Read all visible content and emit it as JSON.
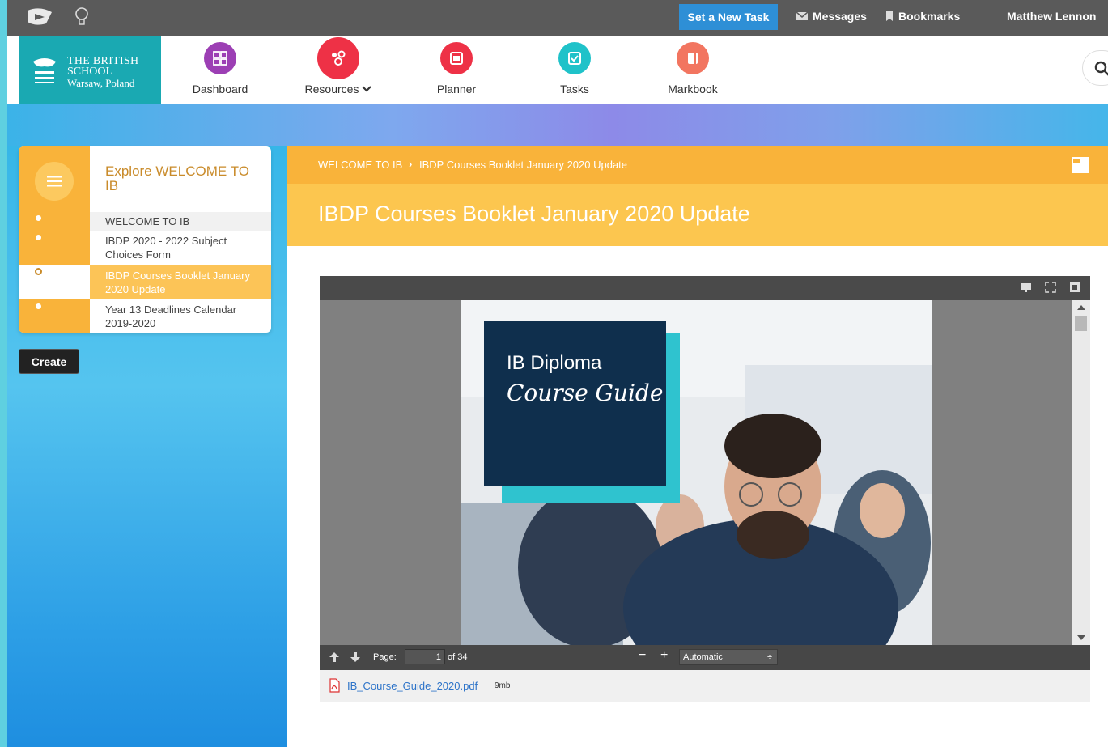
{
  "topbar": {
    "new_task_label": "Set a New Task",
    "messages_label": "Messages",
    "bookmarks_label": "Bookmarks",
    "user_name": "Matthew Lennon"
  },
  "school": {
    "line1": "THE BRITISH",
    "line2": "SCHOOL",
    "line3": "Warsaw, Poland"
  },
  "nav": {
    "items": [
      {
        "label": "Dashboard",
        "color": "#9c3fb4"
      },
      {
        "label": "Resources",
        "color": "#ee3146"
      },
      {
        "label": "Planner",
        "color": "#ee3146"
      },
      {
        "label": "Tasks",
        "color": "#1fc2c9"
      },
      {
        "label": "Markbook",
        "color": "#f27560"
      }
    ]
  },
  "sidebar": {
    "title": "Explore WELCOME TO IB",
    "items": [
      {
        "label": "WELCOME TO IB"
      },
      {
        "label": "IBDP 2020 - 2022 Subject Choices Form"
      },
      {
        "label": "IBDP Courses Booklet  January 2020 Update"
      },
      {
        "label": "Year 13 Deadlines Calendar 2019-2020"
      }
    ],
    "create_label": "Create"
  },
  "breadcrumb": {
    "parent": "WELCOME TO IB",
    "separator": "›",
    "current": "IBDP Courses Booklet  January 2020 Update"
  },
  "page": {
    "title": "IBDP Courses Booklet  January 2020 Update"
  },
  "viewer": {
    "page_label": "Page:",
    "page_value": "1",
    "page_total": "of 34",
    "zoom_value": "Automatic",
    "cover_title": "IB Diploma",
    "cover_subtitle": "Course Guide"
  },
  "attachment": {
    "file_name": "IB_Course_Guide_2020.pdf",
    "file_size": "9mb"
  },
  "colors": {
    "accent_orange": "#f9b33a",
    "light_orange": "#fcc64f",
    "teal": "#1aa9b2",
    "blue_button": "#2e8fd6"
  }
}
